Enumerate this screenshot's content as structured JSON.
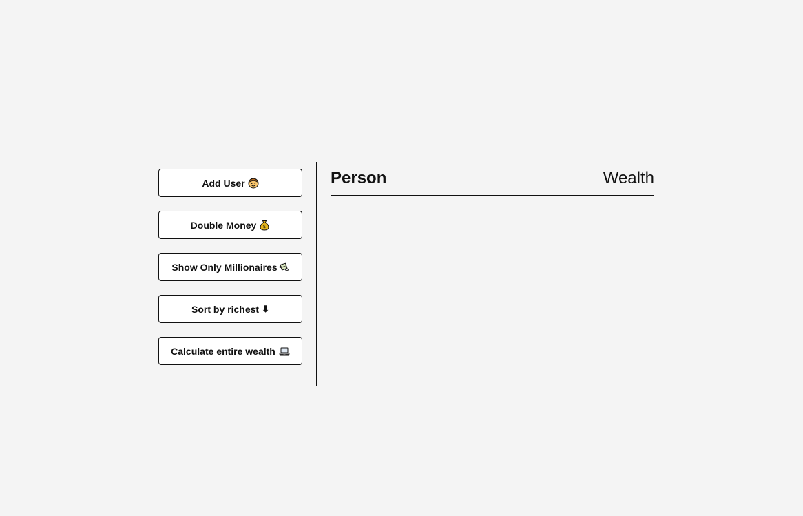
{
  "buttons": [
    {
      "label": "Add User",
      "icon": "person-face-icon"
    },
    {
      "label": "Double Money",
      "icon": "money-bag-icon"
    },
    {
      "label": "Show Only Millionaires",
      "icon": "money-with-wings-icon"
    },
    {
      "label": "Sort by richest",
      "icon": "down-arrow-icon"
    },
    {
      "label": "Calculate entire wealth",
      "icon": "laptop-icon"
    }
  ],
  "table": {
    "person_header": "Person",
    "wealth_header": "Wealth"
  },
  "colors": {
    "background": "#f4f4f4",
    "button_background": "#ffffff",
    "border": "#111111",
    "text": "#111111"
  }
}
